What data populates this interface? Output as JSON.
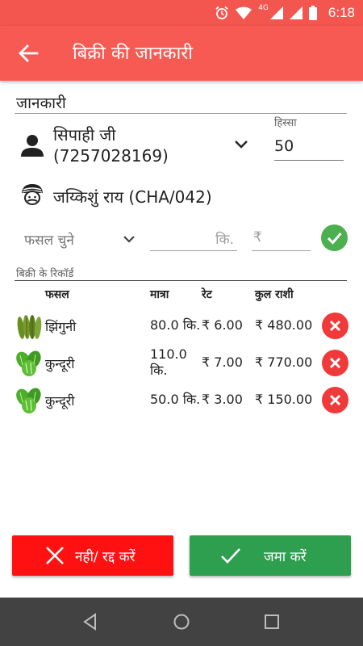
{
  "status_bar": {
    "time": "6:18",
    "network": "4G"
  },
  "app_bar": {
    "title": "बिक्री की जानकारी"
  },
  "info_section": {
    "title": "जानकारी"
  },
  "person": {
    "name": "सिपाही जी",
    "phone": "(7257028169)"
  },
  "share": {
    "label": "हिस्सा",
    "value": "50"
  },
  "farmer": {
    "name": "जय्किशुं राय (CHA/042)"
  },
  "entry": {
    "crop_placeholder": "फसल चुने",
    "unit": "कि.",
    "currency": "₹"
  },
  "records": {
    "label": "बिक्री के रिकॉर्ड",
    "headers": {
      "crop": "फसल",
      "quantity": "मात्रा",
      "rate": "रेट",
      "total": "कुल राशी"
    },
    "rows": [
      {
        "crop": "झिंगुनी",
        "quantity": "80.0 कि.",
        "rate": "₹ 6.00",
        "total": "₹ 480.00",
        "icon": "ridge-gourd-icon"
      },
      {
        "crop": "कुन्दूरी",
        "quantity_line1": "110.0",
        "quantity_line2": "कि.",
        "rate": "₹ 7.00",
        "total": "₹ 770.00",
        "icon": "ivy-gourd-icon"
      },
      {
        "crop": "कुन्दूरी",
        "quantity": "50.0 कि.",
        "rate": "₹ 3.00",
        "total": "₹ 150.00",
        "icon": "ivy-gourd-icon"
      }
    ]
  },
  "buttons": {
    "cancel": "नही/ रद्द करें",
    "submit": "जमा करें"
  },
  "colors": {
    "app_bar": "#f75a53",
    "status_bar": "#f2564f",
    "cancel": "#ff1111",
    "submit": "#2e9e4f",
    "delete": "#f03a3a",
    "confirm": "#4caf50"
  }
}
